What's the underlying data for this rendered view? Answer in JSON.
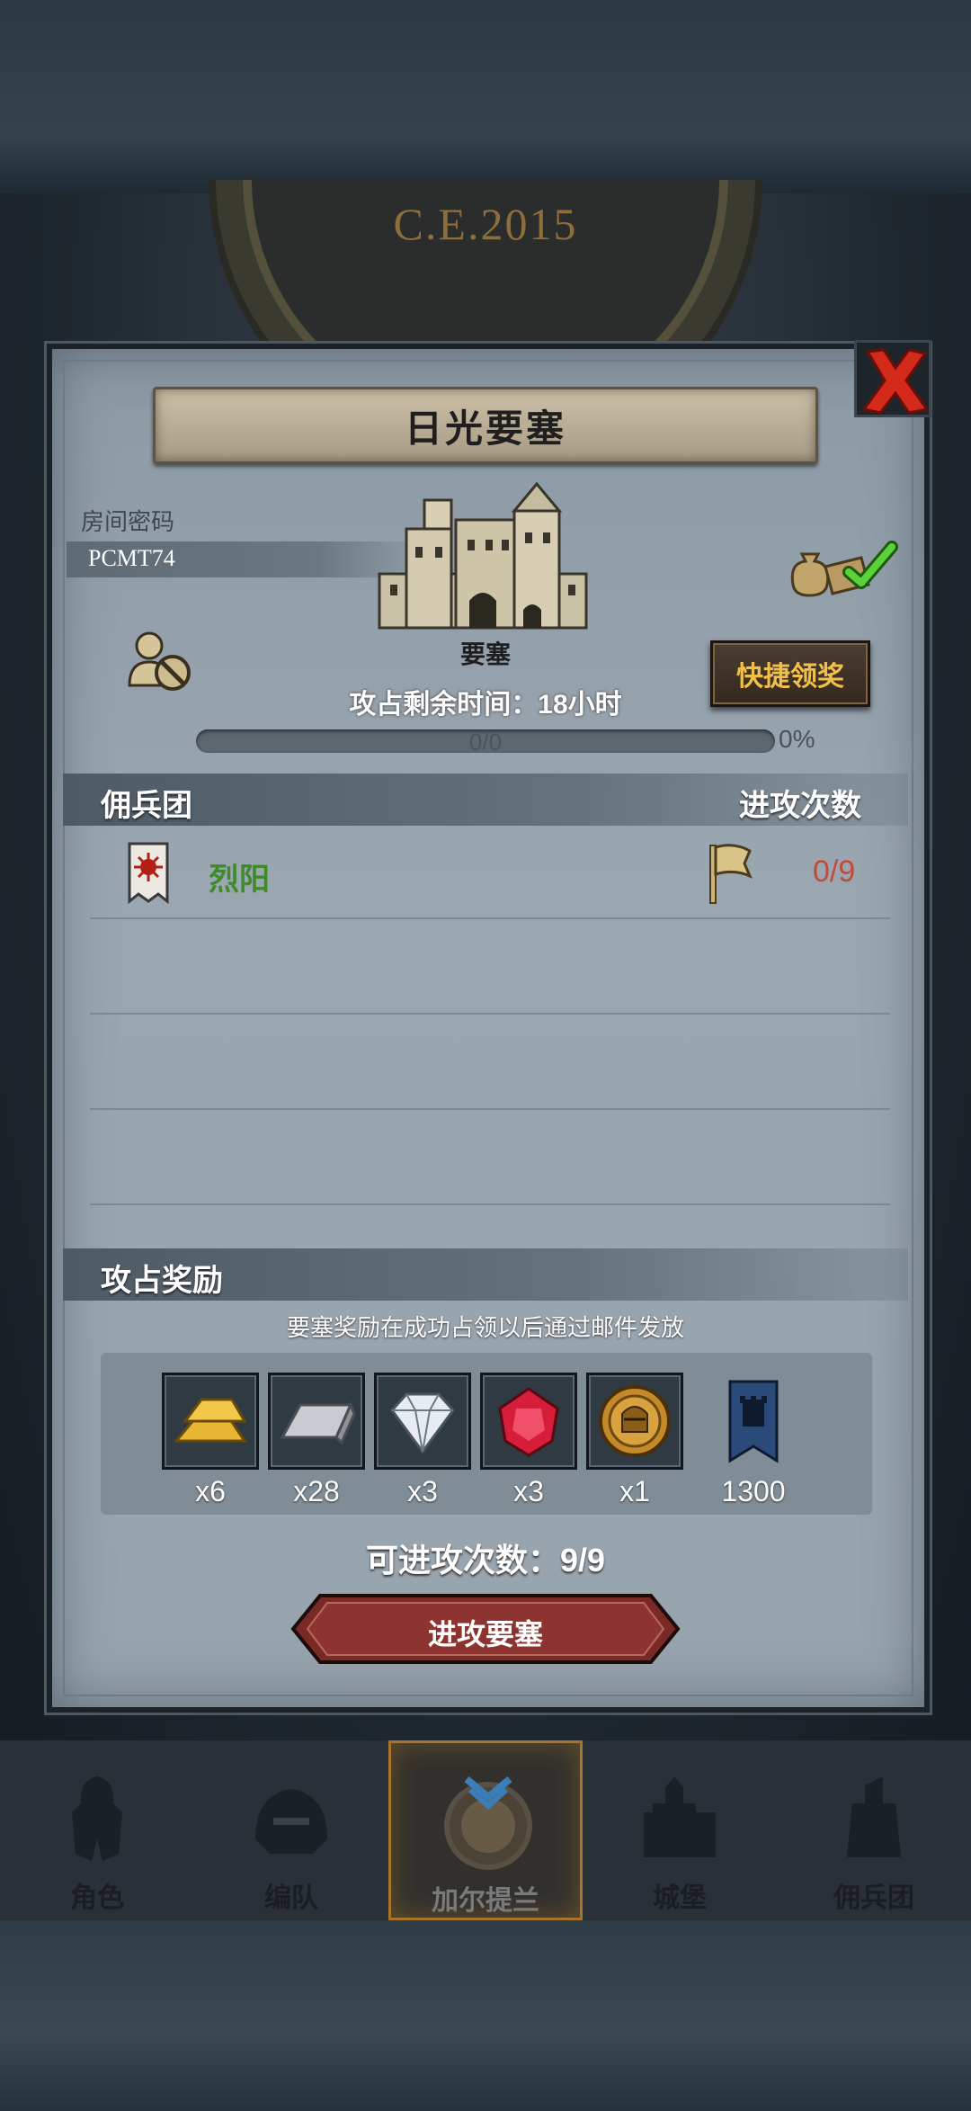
{
  "header": {
    "era": "C.E.2015"
  },
  "dialog": {
    "title": "日光要塞",
    "room_label": "房间密码",
    "room_code": "PCMT74",
    "fortress_name": "要塞",
    "time_remaining": "攻占剩余时间：18小时",
    "progress": {
      "text": "0/0",
      "percent_label": "0%",
      "value": 0
    },
    "quick_reward": "快捷领奖",
    "mercenary_header": "佣兵团",
    "attack_header": "进攻次数",
    "mercenaries": [
      {
        "name": "烈阳",
        "attacks": "0/9"
      }
    ],
    "rewards_header": "攻占奖励",
    "rewards_note": "要塞奖励在成功占领以后通过邮件发放",
    "rewards": [
      {
        "icon": "gold-bar-icon",
        "count": "x6"
      },
      {
        "icon": "silver-bar-icon",
        "count": "x28"
      },
      {
        "icon": "diamond-icon",
        "count": "x3"
      },
      {
        "icon": "ruby-icon",
        "count": "x3"
      },
      {
        "icon": "knight-medal-icon",
        "count": "x1"
      },
      {
        "icon": "guild-banner-icon",
        "count": "1300"
      }
    ],
    "attempts": "可进攻次数：9/9",
    "attack_button": "进攻要塞"
  },
  "nav": [
    {
      "label": "角色",
      "icon": "knight-character-icon"
    },
    {
      "label": "编队",
      "icon": "helmet-squad-icon"
    },
    {
      "label": "加尔提兰",
      "icon": "world-emblem-icon",
      "active": true
    },
    {
      "label": "城堡",
      "icon": "castle-icon"
    },
    {
      "label": "佣兵团",
      "icon": "mercenary-tower-icon"
    }
  ],
  "colors": {
    "accent_gold": "#f2c04a",
    "mercenary_green": "#3f8b2a",
    "attack_red": "#c24a3a",
    "close_red": "#d42a1c"
  }
}
